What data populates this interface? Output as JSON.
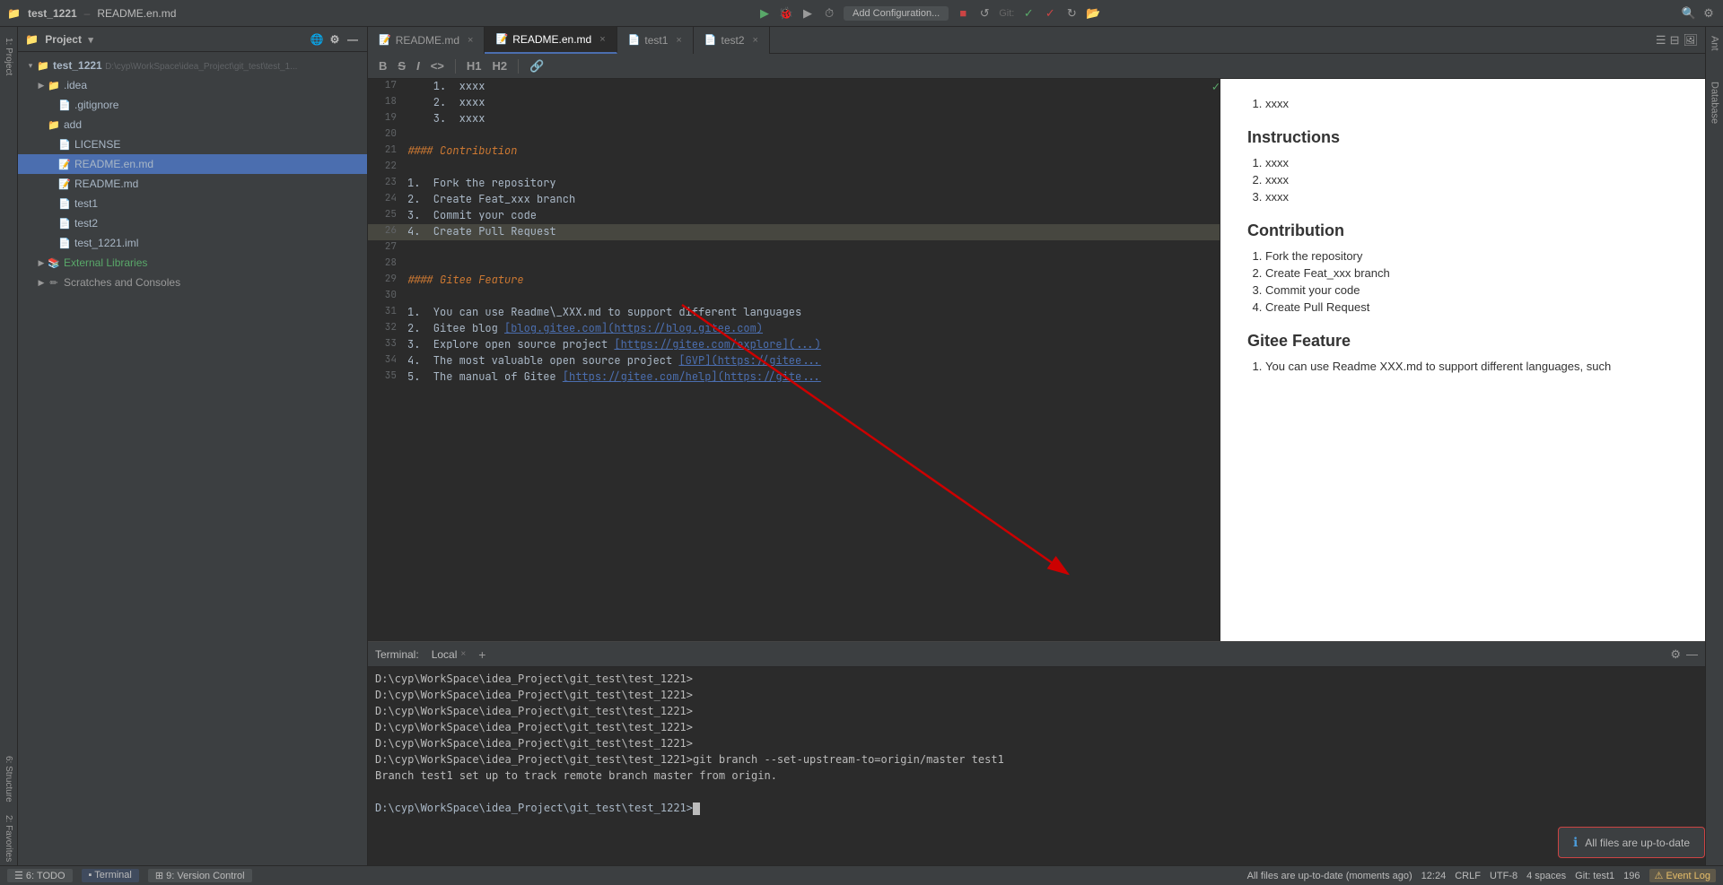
{
  "titleBar": {
    "projectName": "test_1221",
    "activeFile": "README.en.md",
    "addConfigLabel": "Add Configuration...",
    "gitLabel": "Git:"
  },
  "tabs": [
    {
      "label": "README.md",
      "active": false,
      "icon": "md"
    },
    {
      "label": "README.en.md",
      "active": true,
      "icon": "md"
    },
    {
      "label": "test1",
      "active": false,
      "icon": "file"
    },
    {
      "label": "test2",
      "active": false,
      "icon": "file"
    }
  ],
  "toolbar": {
    "bold": "B",
    "strikethrough": "S",
    "italic": "I",
    "code": "<>",
    "h1": "H1",
    "h2": "H2",
    "link": "🔗"
  },
  "sidebar": {
    "title": "Project",
    "rootItem": "test_1221",
    "rootPath": "D:\\cyp\\WorkSpace\\idea_Project\\git_test\\test_1...",
    "items": [
      {
        "name": ".idea",
        "type": "folder",
        "indent": 1,
        "expanded": false
      },
      {
        "name": ".gitignore",
        "type": "git",
        "indent": 1
      },
      {
        "name": "add",
        "type": "folder",
        "indent": 1
      },
      {
        "name": "LICENSE",
        "type": "file",
        "indent": 1
      },
      {
        "name": "README.en.md",
        "type": "md",
        "indent": 1,
        "active": true
      },
      {
        "name": "README.md",
        "type": "md",
        "indent": 1
      },
      {
        "name": "test1",
        "type": "file",
        "indent": 1
      },
      {
        "name": "test2",
        "type": "file",
        "indent": 1
      },
      {
        "name": "test_1221.iml",
        "type": "iml",
        "indent": 1
      }
    ],
    "externalLibs": "External Libraries",
    "scratchesAndConsoles": "Scratches and Consoles"
  },
  "codeLines": [
    {
      "num": 17,
      "text": "    1.  xxxx",
      "type": "normal",
      "checkmark": true
    },
    {
      "num": 18,
      "text": "    2.  xxxx",
      "type": "normal"
    },
    {
      "num": 19,
      "text": "    3.  xxxx",
      "type": "normal"
    },
    {
      "num": 20,
      "text": "",
      "type": "normal"
    },
    {
      "num": 21,
      "text": "#### Contribution",
      "type": "heading"
    },
    {
      "num": 22,
      "text": "",
      "type": "normal"
    },
    {
      "num": 23,
      "text": "1.  Fork the repository",
      "type": "normal"
    },
    {
      "num": 24,
      "text": "2.  Create Feat_xxx branch",
      "type": "normal"
    },
    {
      "num": 25,
      "text": "3.  Commit your code",
      "type": "normal"
    },
    {
      "num": 26,
      "text": "4.  Create Pull Request",
      "type": "normal",
      "highlighted": true
    },
    {
      "num": 27,
      "text": "",
      "type": "normal"
    },
    {
      "num": 28,
      "text": "",
      "type": "normal"
    },
    {
      "num": 29,
      "text": "#### Gitee Feature",
      "type": "heading"
    },
    {
      "num": 30,
      "text": "",
      "type": "normal"
    },
    {
      "num": 31,
      "text": "1.  You can use Readme\\_XXX.md to support different languages",
      "type": "normal"
    },
    {
      "num": 32,
      "text": "2.  Gitee blog [blog.gitee.com](https://blog.gitee.com)",
      "type": "link"
    },
    {
      "num": 33,
      "text": "3.  Explore open source project [https://gitee.com/explore](...)",
      "type": "link"
    },
    {
      "num": 34,
      "text": "4.  The most valuable open source project [GVP](https://gitee...",
      "type": "link"
    },
    {
      "num": 35,
      "text": "5.  The manual of Gitee [https://gitee.com/help](https://gite...",
      "type": "link"
    }
  ],
  "preview": {
    "sections": [
      {
        "title": "Instructions",
        "items": [
          "xxxx",
          "xxxx",
          "xxxx"
        ]
      },
      {
        "title": "Contribution",
        "items": [
          "Fork the repository",
          "Create Feat_xxx branch",
          "Commit your code",
          "Create Pull Request"
        ]
      },
      {
        "title": "Gitee Feature",
        "items": [
          "You can use Readme XXX.md to support different languages, such"
        ]
      }
    ],
    "previewInstructions": {
      "numberedItems": [
        "xxxx",
        "xxxx",
        "xxxx"
      ]
    }
  },
  "terminal": {
    "title": "Terminal:",
    "tabLabel": "Local",
    "addLabel": "+",
    "lines": [
      "D:\\cyp\\WorkSpace\\idea_Project\\git_test\\test_1221>",
      "D:\\cyp\\WorkSpace\\idea_Project\\git_test\\test_1221>",
      "D:\\cyp\\WorkSpace\\idea_Project\\git_test\\test_1221>",
      "D:\\cyp\\WorkSpace\\idea_Project\\git_test\\test_1221>",
      "D:\\cyp\\WorkSpace\\idea_Project\\git_test\\test_1221>",
      "D:\\cyp\\WorkSpace\\idea_Project\\git_test\\test_1221>git branch --set-upstream-to=origin/master test1",
      "Branch test1 set up to track remote branch master from origin.",
      "",
      "D:\\cyp\\WorkSpace\\idea_Project\\git_test\\test_1221>"
    ]
  },
  "statusBar": {
    "left": [
      {
        "label": "6: TODO"
      },
      {
        "label": "Terminal"
      },
      {
        "label": "9: Version Control"
      }
    ],
    "right": [
      {
        "label": "All files are up-to-date (moments ago)"
      },
      {
        "label": "12:24"
      },
      {
        "label": "CRLF"
      },
      {
        "label": "UTF-8"
      },
      {
        "label": "4 spaces"
      },
      {
        "label": "Git: test1"
      },
      {
        "label": "196"
      }
    ]
  },
  "notification": {
    "text": "All files are up-to-date",
    "icon": "ℹ"
  },
  "rightTabs": [
    "Ant",
    "Database"
  ],
  "leftStrip": [
    "1: Project",
    "2: Favorites",
    "6: Structure"
  ]
}
